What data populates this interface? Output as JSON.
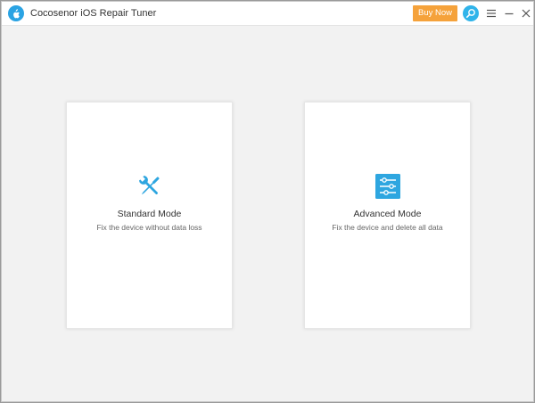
{
  "window": {
    "title": "Cocosenor iOS Repair Tuner"
  },
  "header": {
    "buy_label": "Buy Now",
    "icons": {
      "logo": "apple-logo-icon",
      "search": "search-icon",
      "menu": "menu-icon",
      "minimize": "minimize-icon",
      "close": "close-icon"
    }
  },
  "modes": [
    {
      "title": "Standard Mode",
      "description": "Fix the device without data loss",
      "icon": "tools-icon"
    },
    {
      "title": "Advanced Mode",
      "description": "Fix the device and delete all data",
      "icon": "sliders-icon"
    }
  ],
  "colors": {
    "accent": "#30b4ea",
    "buy": "#f5a23b",
    "background": "#f2f2f2"
  }
}
